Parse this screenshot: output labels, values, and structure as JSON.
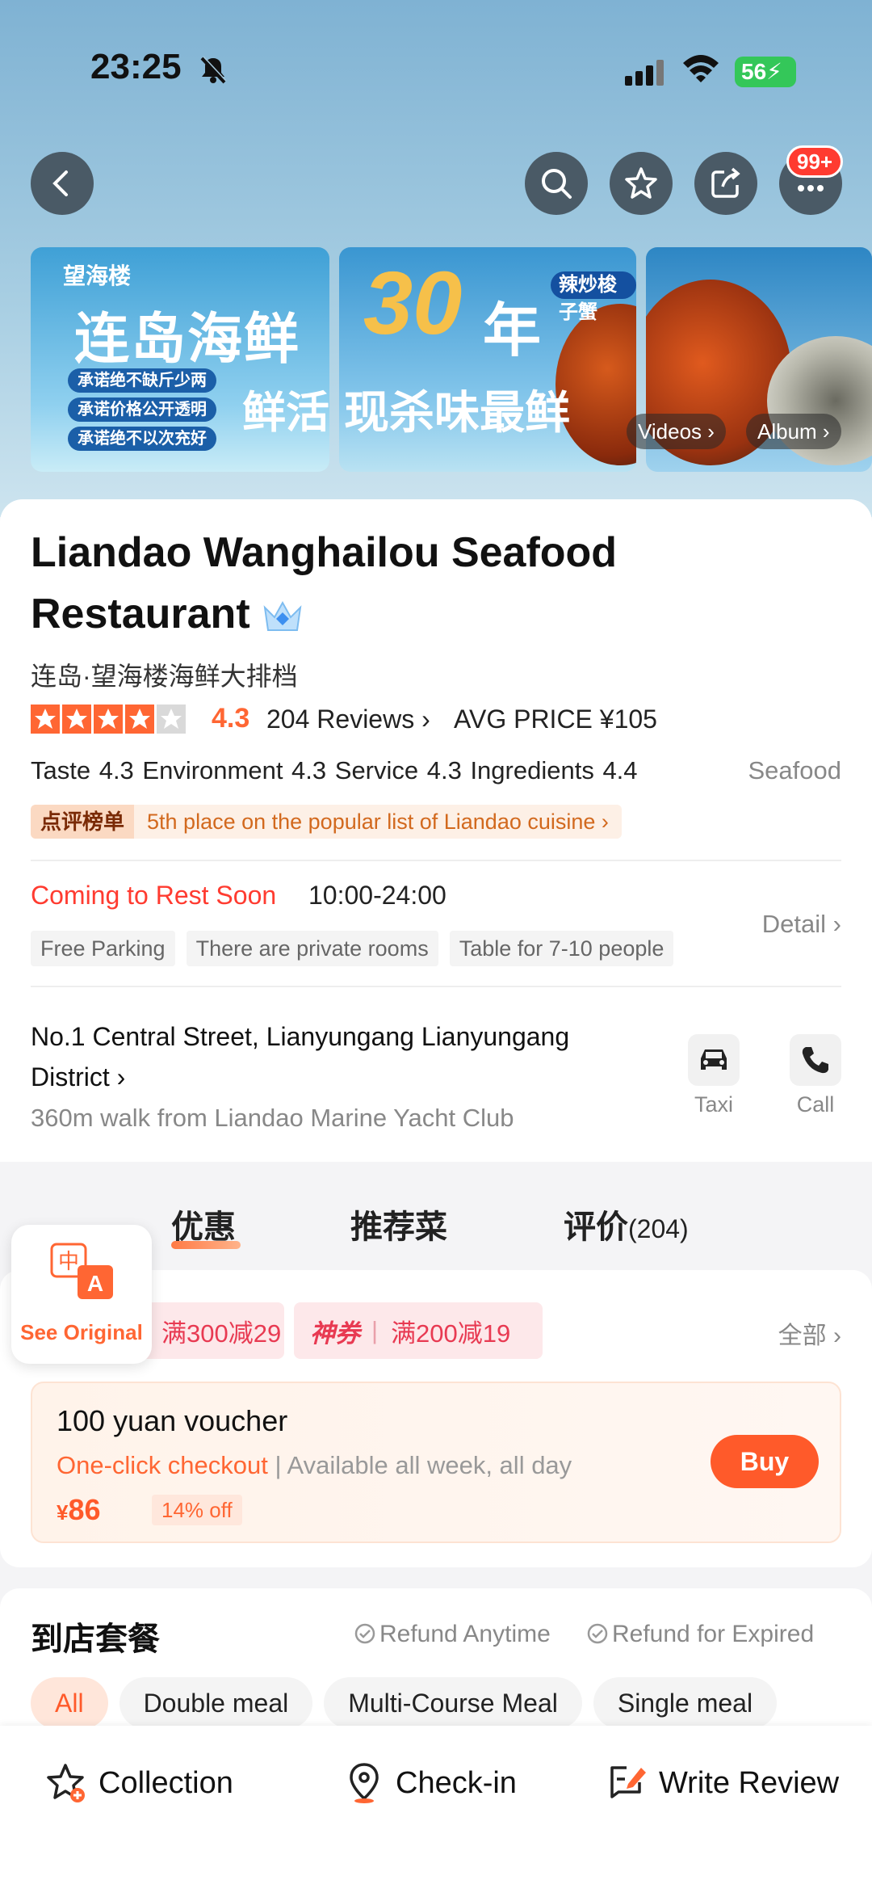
{
  "status": {
    "time": "23:25",
    "battery": "56"
  },
  "nav": {
    "notif_badge": "99+"
  },
  "banner": {
    "logo": "望海楼",
    "headline": "连岛海鲜",
    "promises": [
      "承诺绝不缺斤少两",
      "承诺价格公开透明",
      "承诺绝不以次充好"
    ],
    "line2_left": "鲜活",
    "number": "30",
    "year": "年",
    "line2_right": "现杀味最鲜",
    "dish_tag": "辣炒梭子蟹",
    "videos_label": "Videos",
    "album_label": "Album"
  },
  "restaurant": {
    "name": "Liandao Wanghailou Seafood Restaurant",
    "local_name": "连岛·望海楼海鲜大排档",
    "rating": "4.3",
    "stars_fraction": 0.86,
    "reviews": "204 Reviews",
    "avg_price": "AVG PRICE ¥105",
    "scores": "Taste 4.3  Environment 4.3  Service 4.3  Ingredients 4.4",
    "category": "Seafood",
    "rank_badge": "点评榜单",
    "rank_text": "5th place on the popular list of Liandao cuisine",
    "status": "Coming to Rest Soon",
    "hours": "10:00-24:00",
    "facilities": [
      "Free Parking",
      "There are private rooms",
      "Table for 7-10 people"
    ],
    "detail_label": "Detail",
    "address": "No.1 Central Street, Lianyungang Lianyungang District",
    "walk": "360m walk from Liandao Marine Yacht Club",
    "taxi_label": "Taxi",
    "call_label": "Call"
  },
  "tabs": {
    "deals": "优惠",
    "dishes": "推荐菜",
    "reviews": "评价",
    "reviews_count": "(204)"
  },
  "see_original": {
    "label": "See Original"
  },
  "coupons": {
    "c1": "满300减29",
    "c2_tag": "神券",
    "c2": "满200减19",
    "all": "全部"
  },
  "voucher": {
    "title": "100 yuan voucher",
    "sub1": "One-click checkout",
    "sub2": "Available all week, all day",
    "yen": "¥",
    "price": "86",
    "discount": "14% off",
    "buy": "Buy"
  },
  "package": {
    "title": "到店套餐",
    "refund1": "Refund Anytime",
    "refund2": "Refund for Expired",
    "chips": [
      "All",
      "Double meal",
      "Multi-Course Meal",
      "Single meal"
    ]
  },
  "bottom": {
    "collection": "Collection",
    "checkin": "Check-in",
    "review": "Write Review"
  },
  "colors": {
    "accent": "#ff5a2a",
    "red": "#ff3b30",
    "coupon": "#e83a52"
  }
}
